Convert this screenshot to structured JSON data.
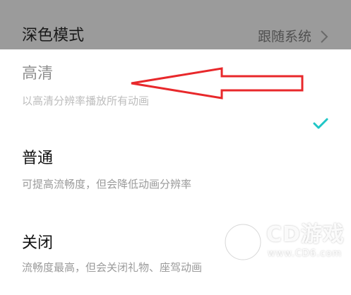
{
  "background_row": {
    "title": "深色模式",
    "value": "跟随系统",
    "chevron_icon": "chevron-right-icon"
  },
  "options": [
    {
      "title": "高清",
      "description": "以高清分辨率播放所有动画",
      "selected": false
    },
    {
      "title": "普通",
      "description": "可提高流畅度，但会降低动画分辨率",
      "selected": true
    },
    {
      "title": "关闭",
      "description": "流畅度最高，但会关闭礼物、座驾动画",
      "selected": false
    }
  ],
  "check_icon": "checkmark-icon",
  "annotation": {
    "icon": "red-arrow-icon",
    "color": "#e8282b"
  },
  "watermark": {
    "text": "CD游戏",
    "url": "www.CD6.com"
  },
  "colors": {
    "accent": "#1fc6c6",
    "dim_overlay": "#9b9b9b"
  }
}
